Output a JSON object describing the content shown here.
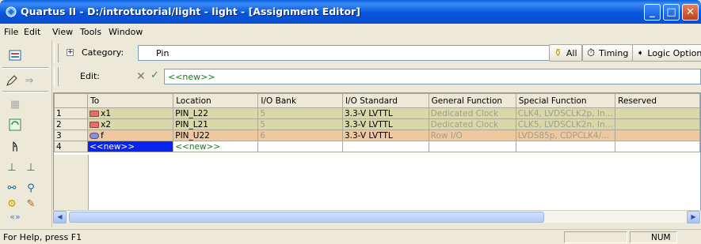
{
  "window": {
    "title": "Quartus II - D:/introtutorial/light - light - [Assignment Editor]",
    "minimize_label": "_",
    "maximize_label": "□",
    "close_label": "✕"
  },
  "menu": [
    {
      "label": "File"
    },
    {
      "label": "Edit"
    },
    {
      "label": "View"
    },
    {
      "label": "Tools"
    },
    {
      "label": "Window"
    }
  ],
  "category": {
    "label": "Category:",
    "value": "Pin",
    "all_label": "All",
    "timing_label": "Timing",
    "logic_options_label": "Logic Options"
  },
  "edit": {
    "label": "Edit:",
    "value": "<<new>>"
  },
  "grid": {
    "columns": [
      "To",
      "Location",
      "I/O Bank",
      "I/O Standard",
      "General Function",
      "Special Function",
      "Reserved"
    ],
    "rows": [
      {
        "num": "1",
        "to": "x1",
        "location": "PIN_L22",
        "bank": "5",
        "standard": "3.3-V LVTTL",
        "general": "Dedicated Clock",
        "special": "CLK4, LVDSCLK2p, In…",
        "reserved": ""
      },
      {
        "num": "2",
        "to": "x2",
        "location": "PIN_L21",
        "bank": "5",
        "standard": "3.3-V LVTTL",
        "general": "Dedicated Clock",
        "special": "CLK5, LVDSCLK2n, In…",
        "reserved": ""
      },
      {
        "num": "3",
        "to": "f",
        "location": "PIN_U22",
        "bank": "6",
        "standard": "3.3-V LVTTL",
        "general": "Row I/O",
        "special": "LVDS85p, CDPCLK4/…",
        "reserved": ""
      },
      {
        "num": "4",
        "to": "<<new>>",
        "location": "<<new>>",
        "bank": "",
        "standard": "",
        "general": "",
        "special": "",
        "reserved": ""
      }
    ]
  },
  "status": {
    "help_text": "For Help, press F1",
    "num_indicator": "NUM"
  },
  "colors": {
    "title_bar": "#0a5fe0",
    "input_row": "#d8d8a8",
    "output_row": "#f0c8a0",
    "selection": "#0a24f0"
  }
}
